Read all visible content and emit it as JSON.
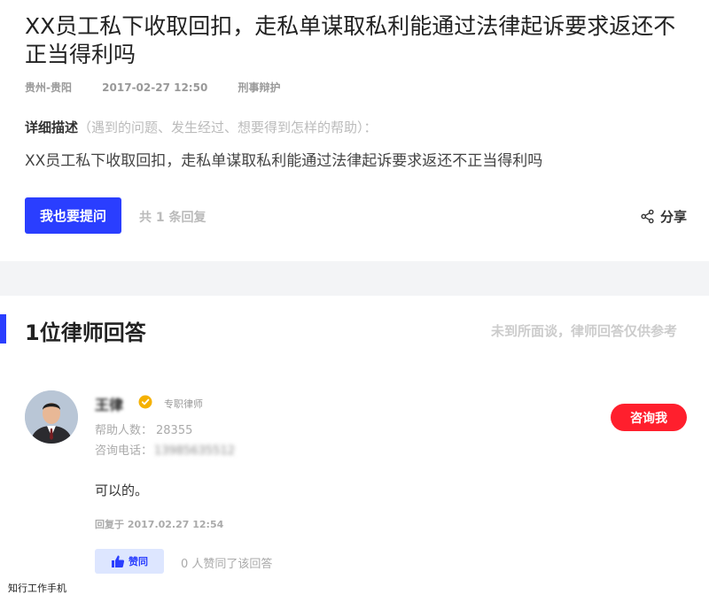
{
  "question": {
    "title": "XX员工私下收取回扣，走私单谋取私利能通过法律起诉要求返还不正当得利吗",
    "location": "贵州-贵阳",
    "date": "2017-02-27 12:50",
    "category": "刑事辩护",
    "desc_label": "详细描述",
    "desc_hint": "（遇到的问题、发生经过、想要得到怎样的帮助）：",
    "desc_text": "XX员工私下收取回扣，走私单谋取私利能通过法律起诉要求返还不正当得利吗",
    "ask_button": "我也要提问",
    "reply_count": "共 1 条回复",
    "share_label": "分享"
  },
  "answers_section": {
    "title": "1位律师回答",
    "disclaimer": "未到所面谈，律师回答仅供参考"
  },
  "answer": {
    "lawyer_name": "王律",
    "lawyer_type": "专职律师",
    "help_label": "帮助人数：",
    "help_count": "28355",
    "phone_label": "咨询电话：",
    "phone_value": "13985635512",
    "consult_button": "咨询我",
    "text": "可以的。",
    "reply_time": "回复于 2017.02.27 12:54",
    "like_label": "赞同",
    "like_count_text": "0 人赞同了该回答"
  },
  "footer": {
    "watermark": "知行工作手机"
  },
  "colors": {
    "accent": "#2a3eff",
    "consult": "#ff1f2d",
    "verified": "#f5b100"
  },
  "icons": {
    "share": "share-icon",
    "verified": "verified-badge-icon",
    "like": "thumbs-up-icon",
    "avatar": "lawyer-avatar"
  }
}
